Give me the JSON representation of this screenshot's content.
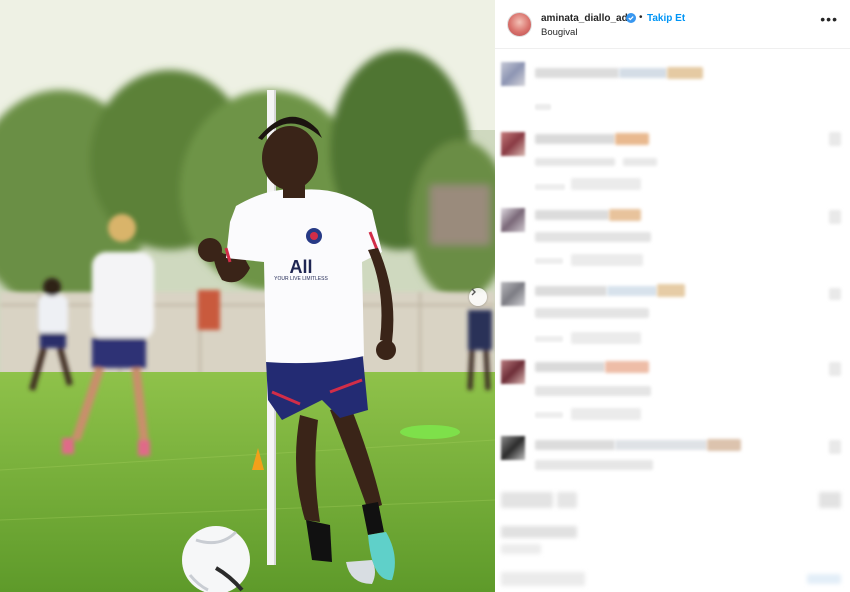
{
  "post": {
    "username": "aminata_diallo_ad",
    "follow_label": "Takip Et",
    "separator": "•",
    "location": "Bougival",
    "more_label": "•••"
  },
  "media": {
    "jersey_text": "All",
    "jersey_subtext": "YOUR LIVE LIMITLESS"
  },
  "colors": {
    "follow_blue": "#0095f6",
    "verified_blue": "#3897f0",
    "text_dark": "#262626"
  },
  "icons": {
    "verified": "verified-badge-icon",
    "next": "chevron-right-icon",
    "more": "more-options-icon"
  }
}
